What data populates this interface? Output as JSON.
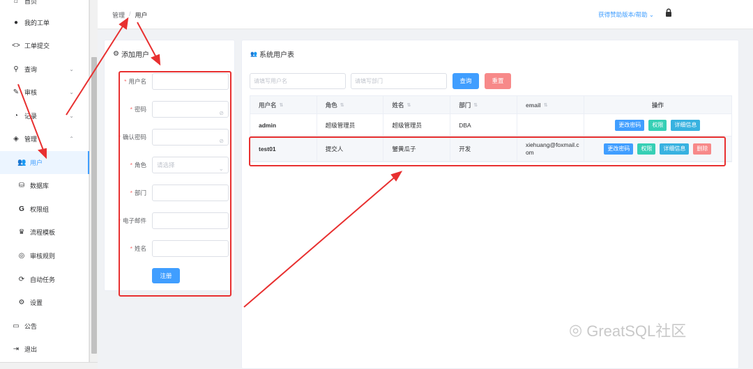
{
  "sidebar": {
    "items": [
      {
        "label": "首页",
        "icon": "home-icon"
      },
      {
        "label": "我的工单",
        "icon": "user-icon"
      },
      {
        "label": "工单提交",
        "icon": "code-icon"
      },
      {
        "label": "查询",
        "icon": "search-icon"
      },
      {
        "label": "审核",
        "icon": "edit-icon"
      },
      {
        "label": "记录",
        "icon": "pie-chart-icon"
      },
      {
        "label": "管理",
        "icon": "layers-icon"
      },
      {
        "label": "用户",
        "icon": "users-icon"
      },
      {
        "label": "数据库",
        "icon": "database-icon"
      },
      {
        "label": "权限组",
        "icon": "google-icon"
      },
      {
        "label": "流程模板",
        "icon": "trophy-icon"
      },
      {
        "label": "审核规则",
        "icon": "chrome-icon"
      },
      {
        "label": "自动任务",
        "icon": "sync-icon"
      },
      {
        "label": "设置",
        "icon": "gear-icon"
      },
      {
        "label": "公告",
        "icon": "clipboard-icon"
      },
      {
        "label": "退出",
        "icon": "logout-icon"
      }
    ]
  },
  "header": {
    "breadcrumb": [
      "管理",
      "用户"
    ],
    "breadcrumb_sep": "/",
    "help_label": "获得赞助版本/帮助",
    "help_chevron": "⌄"
  },
  "add_user": {
    "title": "添加用户",
    "fields": [
      {
        "label": "用户名",
        "placeholder": ""
      },
      {
        "label": "密码",
        "placeholder": ""
      },
      {
        "label": "确认密码",
        "placeholder": ""
      },
      {
        "label": "角色",
        "placeholder": "请选择"
      },
      {
        "label": "部门",
        "placeholder": ""
      },
      {
        "label": "电子邮件",
        "placeholder": ""
      },
      {
        "label": "姓名",
        "placeholder": ""
      }
    ],
    "submit_label": "注册"
  },
  "user_table": {
    "title": "系统用户表",
    "search_user_placeholder": "请填写用户名",
    "search_dept_placeholder": "请填写部门",
    "search_label": "查询",
    "reset_label": "重置",
    "columns": [
      "用户名",
      "角色",
      "姓名",
      "部门",
      "email",
      "操作"
    ],
    "rows": [
      {
        "username": "admin",
        "role": "超级管理员",
        "name": "超级管理员",
        "dept": "DBA",
        "email": "",
        "actions": [
          "更改密码",
          "权限",
          "详细信息"
        ]
      },
      {
        "username": "test01",
        "role": "提交人",
        "name": "蟹黄瓜子",
        "dept": "开发",
        "email": "xiehuang@foxmail.com",
        "actions": [
          "更改密码",
          "权限",
          "详细信息",
          "删除"
        ]
      }
    ]
  },
  "watermark": {
    "text": "GreatSQL社区"
  },
  "colors": {
    "accent": "#409eff",
    "danger": "#f78989",
    "annotation": "#e83030"
  }
}
